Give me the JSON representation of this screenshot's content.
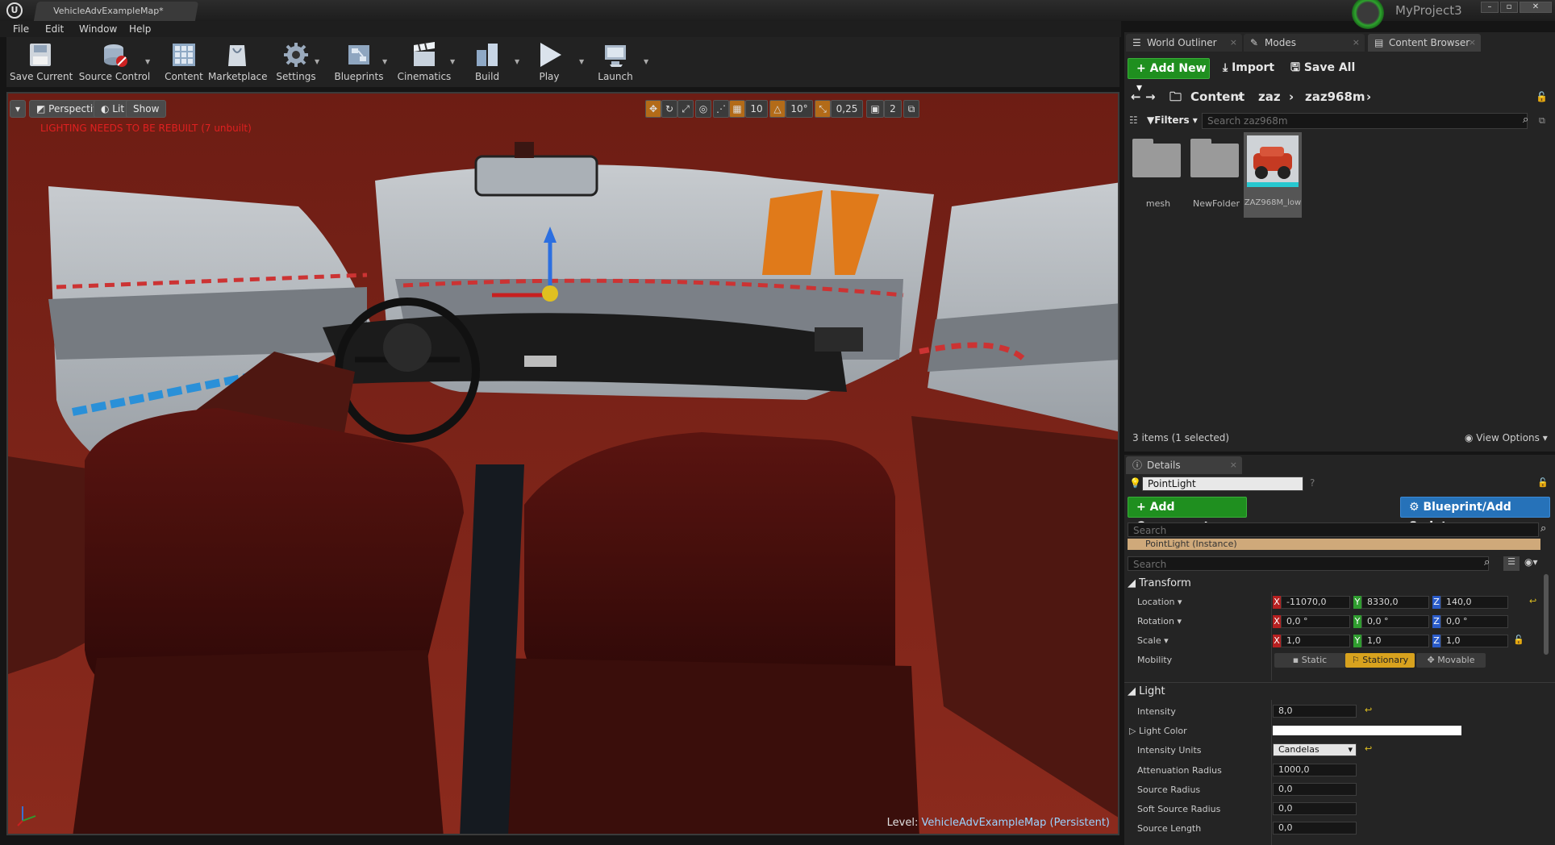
{
  "window": {
    "tab_title": "VehicleAdvExampleMap*",
    "project_name": "MyProject3",
    "controls": [
      "–",
      "▫",
      "✕"
    ]
  },
  "menu": [
    "File",
    "Edit",
    "Window",
    "Help"
  ],
  "toolbar": {
    "buttons": [
      {
        "label": "Save Current",
        "icon": "save-icon"
      },
      {
        "label": "Source Control",
        "icon": "source-control-icon"
      },
      {
        "label": "Content",
        "icon": "content-icon"
      },
      {
        "label": "Marketplace",
        "icon": "marketplace-icon"
      },
      {
        "label": "Settings",
        "icon": "settings-icon"
      },
      {
        "label": "Blueprints",
        "icon": "blueprints-icon"
      },
      {
        "label": "Cinematics",
        "icon": "cinematics-icon"
      },
      {
        "label": "Build",
        "icon": "build-icon"
      },
      {
        "label": "Play",
        "icon": "play-icon"
      },
      {
        "label": "Launch",
        "icon": "launch-icon"
      }
    ]
  },
  "viewport": {
    "view_mode": "Perspective",
    "lit_mode": "Lit",
    "show": "Show",
    "lighting_warning": "LIGHTING NEEDS TO BE REBUILT (7 unbuilt)",
    "grid_snap": "10",
    "rotation_snap": "10°",
    "scale_snap": "0,25",
    "camera_speed": "2",
    "level_prefix": "Level:",
    "level_name": "VehicleAdvExampleMap (Persistent)"
  },
  "panels": {
    "tabs": [
      "World Outliner",
      "Modes",
      "Content Browser"
    ],
    "close": "×"
  },
  "content_browser": {
    "add_new": "Add New",
    "import": "Import",
    "save_all": "Save All",
    "breadcrumb": [
      "Content",
      "zaz",
      "zaz968m"
    ],
    "filters": "Filters",
    "search_placeholder": "Search zaz968m",
    "assets": [
      {
        "name": "mesh",
        "type": "folder"
      },
      {
        "name": "NewFolder",
        "type": "folder"
      },
      {
        "name": "ZAZ968M_low",
        "type": "mesh",
        "selected": true
      }
    ],
    "item_count": "3 items (1 selected)",
    "view_options": "View Options"
  },
  "details": {
    "tab": "Details",
    "actor_name": "PointLight",
    "add_component": "Add Component",
    "blueprint": "Blueprint/Add Script",
    "search_placeholder": "Search",
    "component": "PointLight (Instance)",
    "search2_placeholder": "Search",
    "transform": {
      "header": "Transform",
      "location_label": "Location",
      "rotation_label": "Rotation",
      "scale_label": "Scale",
      "mobility_label": "Mobility",
      "location": [
        "-11070,0",
        "8330,0",
        "140,0"
      ],
      "rotation": [
        "0,0 °",
        "0,0 °",
        "0,0 °"
      ],
      "scale": [
        "1,0",
        "1,0",
        "1,0"
      ],
      "mobility": [
        "Static",
        "Stationary",
        "Movable"
      ],
      "mobility_selected": "Stationary"
    },
    "light": {
      "header": "Light",
      "intensity_label": "Intensity",
      "intensity": "8,0",
      "light_color_label": "Light Color",
      "light_color": "#ffffff",
      "units_label": "Intensity Units",
      "units": "Candelas",
      "attenuation_label": "Attenuation Radius",
      "attenuation": "1000,0",
      "source_radius_label": "Source Radius",
      "source_radius": "0,0",
      "soft_source_label": "Soft Source Radius",
      "soft_source": "0,0",
      "source_length_label": "Source Length",
      "source_length": "0,0"
    }
  },
  "colors": {
    "accent_green": "#1f8f1f",
    "accent_blue": "#2672b9",
    "stationary": "#d8a21e",
    "warning": "#e02020"
  }
}
